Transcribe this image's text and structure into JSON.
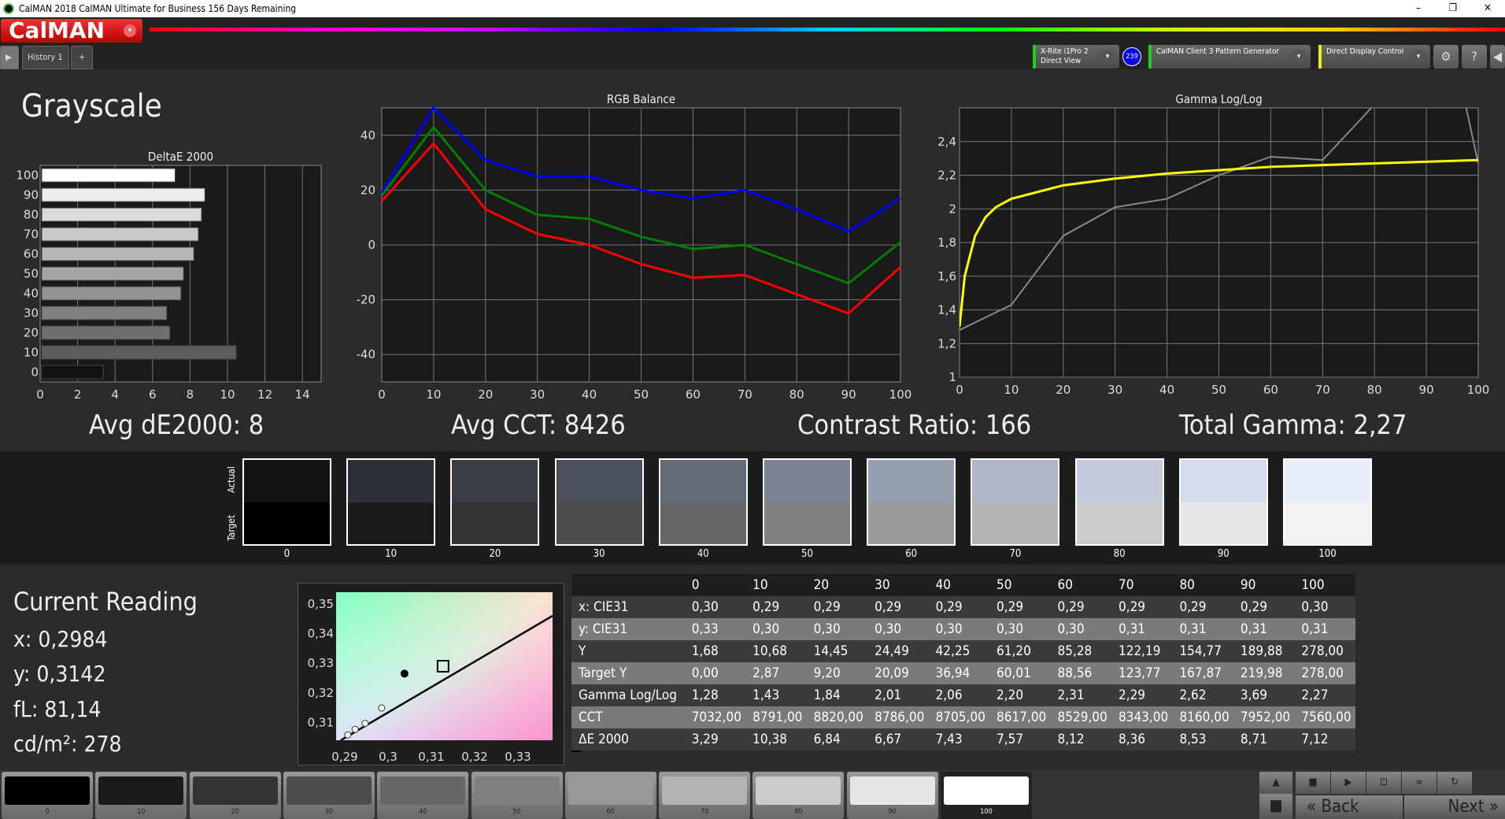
{
  "window": {
    "title": "CalMAN 2018 CalMAN Ultimate for Business 156 Days Remaining",
    "minimize": "–",
    "restore": "❐",
    "close": "✕"
  },
  "app": {
    "logo": "CalMAN",
    "logo_dd": "▾",
    "tabs": [
      {
        "label": "History 1"
      }
    ],
    "add_tab": "+",
    "play": "▶"
  },
  "devices": {
    "meter": "X-Rite i1Pro 2\nDirect View",
    "meter_badge": "239",
    "pattern": "CalMAN Client 3 Pattern Generator",
    "display": "Direct Display Control",
    "dd": "▾",
    "gear": "⚙",
    "help": "?",
    "collapse": "◀",
    "colors": {
      "meter": "#22cc22",
      "pattern": "#22cc22",
      "display": "#e0e000",
      "badge": "#0000ee"
    }
  },
  "page": {
    "title": "Grayscale"
  },
  "summary": {
    "avg_de": "Avg dE2000: 8",
    "avg_cct": "Avg CCT: 8426",
    "contrast": "Contrast Ratio: 166",
    "gamma": "Total Gamma: 2,27"
  },
  "chart_data": [
    {
      "type": "bar",
      "orientation": "horizontal",
      "title": "DeltaE 2000",
      "categories": [
        "0",
        "10",
        "20",
        "30",
        "40",
        "50",
        "60",
        "70",
        "80",
        "90",
        "100"
      ],
      "values": [
        3.29,
        10.38,
        6.84,
        6.67,
        7.43,
        7.57,
        8.12,
        8.36,
        8.53,
        8.71,
        7.12
      ],
      "xlim": [
        0,
        15
      ],
      "xticks": [
        "0",
        "2",
        "4",
        "6",
        "8",
        "10",
        "12",
        "14"
      ]
    },
    {
      "type": "line",
      "title": "RGB Balance",
      "x": [
        0,
        10,
        20,
        30,
        40,
        50,
        60,
        70,
        80,
        90,
        100
      ],
      "ylim": [
        -50,
        50
      ],
      "yticks": [
        "40",
        "20",
        "0",
        "-20",
        "-40"
      ],
      "xticks": [
        "0",
        "10",
        "20",
        "30",
        "40",
        "50",
        "60",
        "70",
        "80",
        "90",
        "100"
      ],
      "series": [
        {
          "color": "#0000ff",
          "values": [
            19,
            50,
            31,
            25,
            25,
            20,
            17,
            20,
            13,
            5,
            17
          ]
        },
        {
          "color": "#008000",
          "values": [
            18,
            43,
            20,
            11,
            9.5,
            3,
            -1.5,
            0,
            -7,
            -14,
            1
          ]
        },
        {
          "color": "#ff0000",
          "values": [
            16,
            37,
            13,
            4,
            0,
            -7,
            -12,
            -11,
            -18,
            -25,
            -8
          ]
        }
      ]
    },
    {
      "type": "line",
      "title": "Gamma Log/Log",
      "ylim": [
        1,
        2.6
      ],
      "xlim": [
        0,
        100
      ],
      "yticks": [
        "2,4",
        "2,2",
        "2",
        "1,8",
        "1,6",
        "1,4",
        "1,2",
        "1"
      ],
      "xticks": [
        "0",
        "10",
        "20",
        "30",
        "40",
        "50",
        "60",
        "70",
        "80",
        "90",
        "100"
      ],
      "series": [
        {
          "color": "#888888",
          "x": [
            0,
            10,
            20,
            30,
            40,
            50,
            60,
            70,
            80,
            90,
            100
          ],
          "values": [
            1.28,
            1.43,
            1.84,
            2.01,
            2.06,
            2.2,
            2.31,
            2.29,
            2.62,
            3.69,
            2.27
          ]
        },
        {
          "color": "#ffff00",
          "x": [
            0,
            1,
            3,
            5,
            7,
            10,
            15,
            20,
            30,
            40,
            50,
            60,
            70,
            80,
            90,
            100
          ],
          "values": [
            1.3,
            1.6,
            1.84,
            1.95,
            2.01,
            2.06,
            2.1,
            2.14,
            2.18,
            2.21,
            2.23,
            2.25,
            2.26,
            2.27,
            2.28,
            2.29
          ]
        }
      ]
    },
    {
      "type": "scatter",
      "title": "",
      "xlim": [
        0.288,
        0.338
      ],
      "ylim": [
        0.304,
        0.354
      ],
      "xticks": [
        "0,29",
        "0,3",
        "0,31",
        "0,32",
        "0,33"
      ],
      "yticks": [
        "0,35",
        "0,34",
        "0,33",
        "0,32",
        "0,31"
      ],
      "target": {
        "x": 0.3127,
        "y": 0.329
      },
      "current": {
        "x": 0.3038,
        "y": 0.3265
      },
      "history": [
        {
          "x": 0.2907,
          "y": 0.3058
        },
        {
          "x": 0.2924,
          "y": 0.3077
        },
        {
          "x": 0.2947,
          "y": 0.3097
        },
        {
          "x": 0.2985,
          "y": 0.3149
        }
      ]
    }
  ],
  "swatches": {
    "actual_label": "Actual",
    "target_label": "Target",
    "items": [
      {
        "label": "0",
        "actual": "#101214",
        "target": "#000000"
      },
      {
        "label": "10",
        "actual": "#2c3038",
        "target": "#1a1a1a"
      },
      {
        "label": "20",
        "actual": "#383d46",
        "target": "#333333"
      },
      {
        "label": "30",
        "actual": "#4b515c",
        "target": "#4d4d4d"
      },
      {
        "label": "40",
        "actual": "#646b78",
        "target": "#666666"
      },
      {
        "label": "50",
        "actual": "#7c8494",
        "target": "#808080"
      },
      {
        "label": "60",
        "actual": "#959eae",
        "target": "#9a9a9a"
      },
      {
        "label": "70",
        "actual": "#b0b8c8",
        "target": "#b3b3b3"
      },
      {
        "label": "80",
        "actual": "#c4ccdc",
        "target": "#cccccc"
      },
      {
        "label": "90",
        "actual": "#d4dcec",
        "target": "#e6e6e6"
      },
      {
        "label": "100",
        "actual": "#e8eefc",
        "target": "#f2f2f2"
      }
    ]
  },
  "current_reading": {
    "title": "Current Reading",
    "x": "x: 0,2984",
    "y": "y: 0,3142",
    "fl": "fL: 81,14",
    "cdm2": "cd/m²: 278"
  },
  "table": {
    "headers": [
      "",
      "0",
      "10",
      "20",
      "30",
      "40",
      "50",
      "60",
      "70",
      "80",
      "90",
      "100"
    ],
    "rows": [
      [
        "x: CIE31",
        "0,30",
        "0,29",
        "0,29",
        "0,29",
        "0,29",
        "0,29",
        "0,29",
        "0,29",
        "0,29",
        "0,29",
        "0,30"
      ],
      [
        "y: CIE31",
        "0,33",
        "0,30",
        "0,30",
        "0,30",
        "0,30",
        "0,30",
        "0,30",
        "0,31",
        "0,31",
        "0,31",
        "0,31"
      ],
      [
        "Y",
        "1,68",
        "10,68",
        "14,45",
        "24,49",
        "42,25",
        "61,20",
        "85,28",
        "122,19",
        "154,77",
        "189,88",
        "278,00"
      ],
      [
        "Target Y",
        "0,00",
        "2,87",
        "9,20",
        "20,09",
        "36,94",
        "60,01",
        "88,56",
        "123,77",
        "167,87",
        "219,98",
        "278,00"
      ],
      [
        "Gamma Log/Log",
        "1,28",
        "1,43",
        "1,84",
        "2,01",
        "2,06",
        "2,20",
        "2,31",
        "2,29",
        "2,62",
        "3,69",
        "2,27"
      ],
      [
        "CCT",
        "7032,00",
        "8791,00",
        "8820,00",
        "8786,00",
        "8705,00",
        "8617,00",
        "8529,00",
        "8343,00",
        "8160,00",
        "7952,00",
        "7560,00"
      ],
      [
        "ΔE 2000",
        "3,29",
        "10,38",
        "6,84",
        "6,67",
        "7,43",
        "7,57",
        "8,12",
        "8,36",
        "8,53",
        "8,71",
        "7,12"
      ]
    ]
  },
  "patterns": {
    "selected": "100",
    "items": [
      {
        "label": "0",
        "color": "#000000"
      },
      {
        "label": "10",
        "color": "#1a1a1a"
      },
      {
        "label": "20",
        "color": "#333333"
      },
      {
        "label": "30",
        "color": "#4d4d4d"
      },
      {
        "label": "40",
        "color": "#666666"
      },
      {
        "label": "50",
        "color": "#808080"
      },
      {
        "label": "60",
        "color": "#999999"
      },
      {
        "label": "70",
        "color": "#b3b3b3"
      },
      {
        "label": "80",
        "color": "#cccccc"
      },
      {
        "label": "90",
        "color": "#e6e6e6"
      },
      {
        "label": "100",
        "color": "#ffffff"
      }
    ]
  },
  "nav": {
    "back": "Back",
    "next": "Next",
    "back_icon": "«",
    "next_icon": "»",
    "up": "▲",
    "stop": "■",
    "controls": [
      "■",
      "▶",
      "⊡",
      "∞",
      "↻"
    ]
  }
}
